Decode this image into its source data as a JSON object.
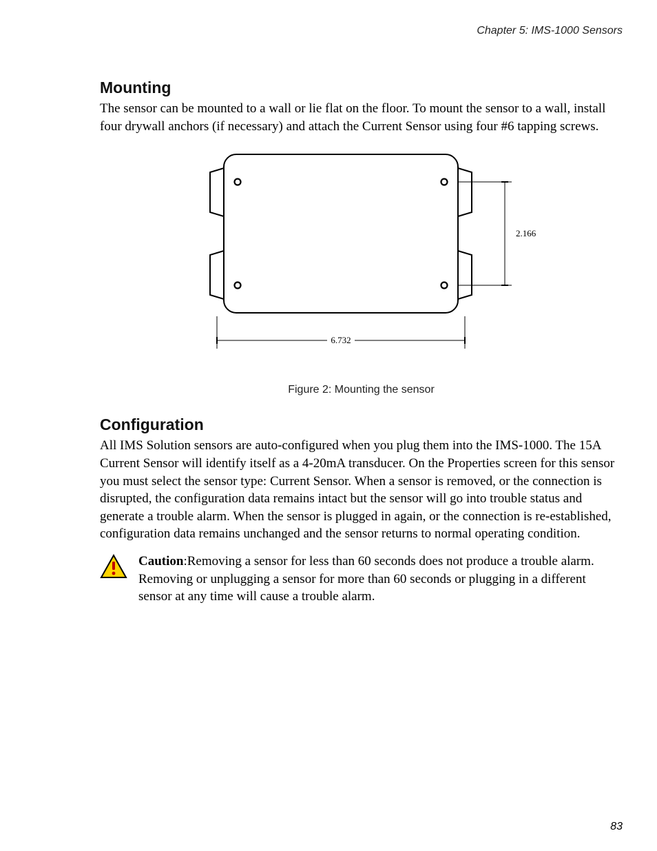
{
  "header": {
    "running_head": "Chapter 5: IMS-1000 Sensors"
  },
  "mounting": {
    "heading": "Mounting",
    "paragraph": "The sensor can be mounted to a wall or lie flat on the floor. To mount the sensor to a wall, install four drywall anchors (if necessary) and attach the Current Sensor using four #6 tapping screws."
  },
  "figure": {
    "caption": "Figure 2: Mounting the sensor",
    "dimensions": {
      "width_label": "6.732",
      "height_label": "2.166"
    }
  },
  "configuration": {
    "heading": "Configuration",
    "paragraph": "All IMS Solution sensors are auto-configured when you plug them into the IMS-1000. The 15A Current Sensor will identify itself as a 4-20mA transducer. On the Properties screen for this sensor you must select the sensor type: Current Sensor. When a sensor is removed, or the connection is disrupted, the configuration data remains intact but the sensor will go into trouble status and generate a trouble alarm. When the sensor is plugged in again, or the connection is re-established, configuration data remains unchanged and the sensor returns to normal operating condition."
  },
  "caution": {
    "label": "Caution",
    "text": ":Removing a sensor for less than 60 seconds does not produce a trouble alarm. Removing or unplugging a sensor for more than 60 seconds or plugging in a different sensor at any time will cause a trouble alarm."
  },
  "page_number": "83"
}
